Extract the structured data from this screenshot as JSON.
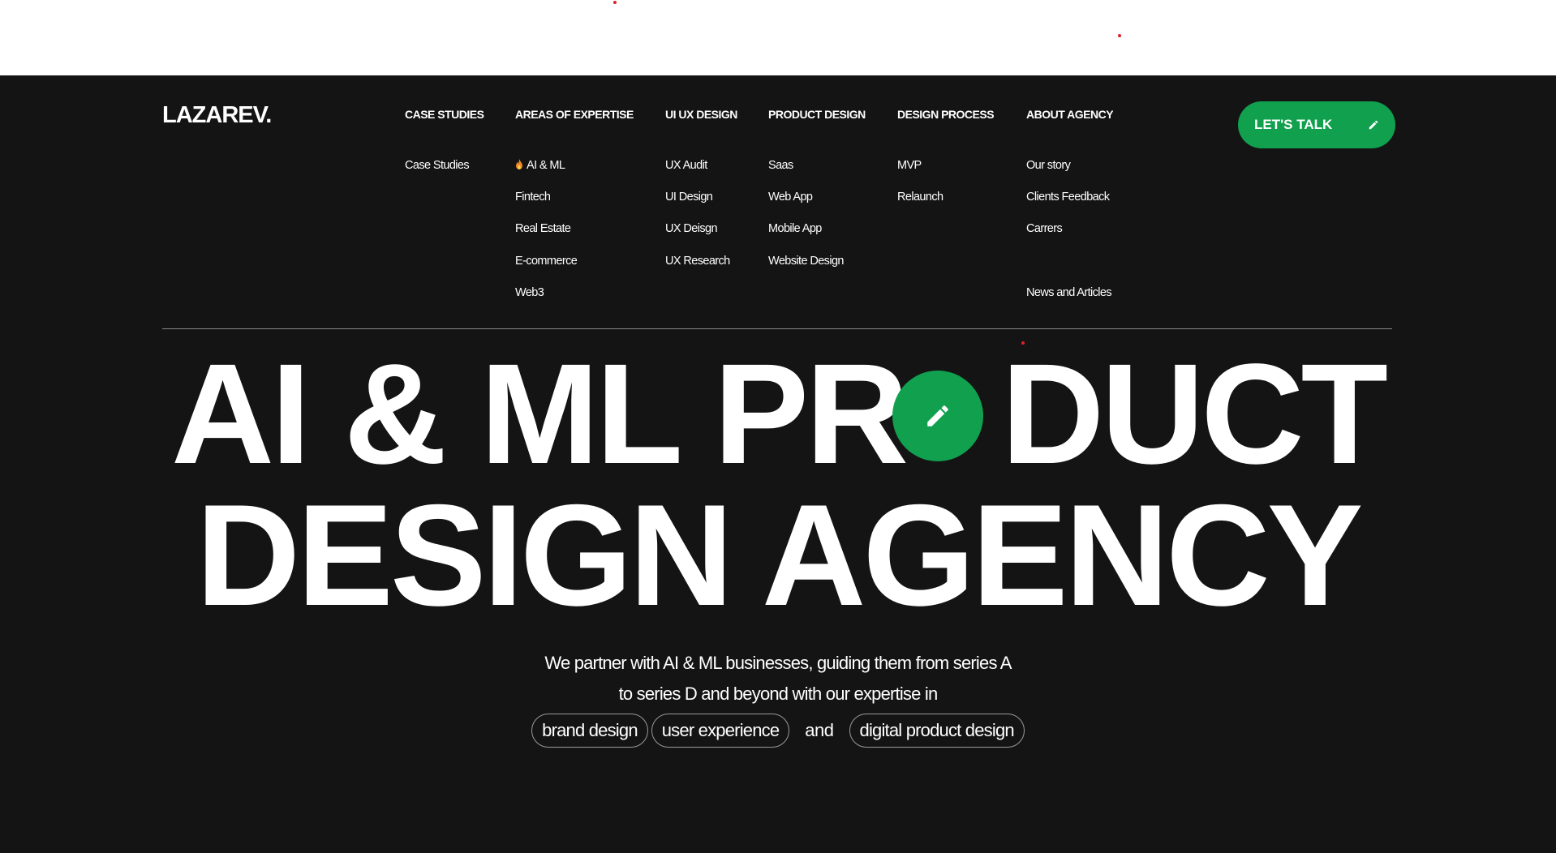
{
  "brand": {
    "logo": "LAZAREV.",
    "accent": "#10a04e",
    "background": "#141414"
  },
  "nav": {
    "columns": [
      {
        "heading": "CASE STUDIES",
        "items": [
          "Case Studies"
        ]
      },
      {
        "heading": "AREAS OF EXPERTISE",
        "items": [
          "AI & ML",
          "Fintech",
          "Real Estate",
          "E-commerce",
          "Web3"
        ]
      },
      {
        "heading": "UI UX DESIGN",
        "items": [
          "UX Audit",
          "UI Design",
          "UX Deisgn",
          "UX Research"
        ]
      },
      {
        "heading": "PRODUCT DESIGN",
        "items": [
          "Saas",
          "Web App",
          "Mobile App",
          "Website Design"
        ]
      },
      {
        "heading": "DESIGN PROCESS",
        "items": [
          "MVP",
          "Relaunch"
        ]
      },
      {
        "heading": "ABOUT AGENCY",
        "items": [
          "Our story",
          "Clients Feedback",
          "Carrers",
          "News and Articles"
        ]
      }
    ],
    "first_item_icon": "flame-icon"
  },
  "cta": {
    "label": "LET'S TALK",
    "icon": "pencil-icon"
  },
  "hero": {
    "line1_before": "AI & ML PR",
    "line1_after": "DUCT",
    "line2": "DESIGN AGENCY",
    "badge_icon": "pencil-icon"
  },
  "tagline": {
    "line1": "We partner with AI & ML businesses, guiding them from series A",
    "line2": "to series D and beyond with our expertise in",
    "chip1": "brand design",
    "chip2": "user experience",
    "connector": "and",
    "chip3": "digital product design"
  }
}
